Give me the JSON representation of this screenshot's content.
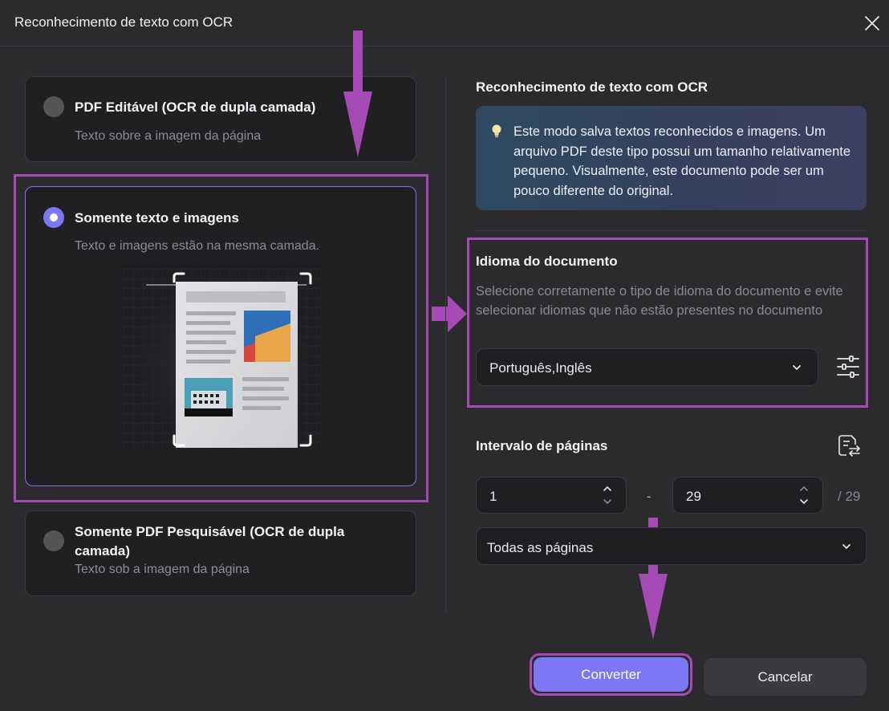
{
  "dialog": {
    "title": "Reconhecimento de texto com OCR"
  },
  "options": [
    {
      "title": "PDF Editável (OCR de dupla camada)",
      "desc": "Texto sobre a imagem da página",
      "selected": false
    },
    {
      "title": "Somente texto e imagens",
      "desc": "Texto e imagens estão na mesma camada.",
      "selected": true
    },
    {
      "title": "Somente PDF Pesquisável (OCR de dupla camada)",
      "desc": "Texto sob a imagem da página",
      "selected": false
    }
  ],
  "right": {
    "section_title": "Reconhecimento de texto com OCR",
    "info_icon": "lightbulb-icon",
    "info_text": "Este modo salva textos reconhecidos e imagens. Um arquivo PDF deste tipo possui um tamanho relativamente pequeno. Visualmente, este documento pode ser um pouco diferente do original.",
    "language": {
      "title": "Idioma do documento",
      "hint": "Selecione corretamente o tipo de idioma do documento e evite selecionar idiomas que não estão presentes no documento",
      "value": "Português,Inglês",
      "settings_icon": "sliders-icon"
    },
    "pages": {
      "title": "Intervalo de páginas",
      "from": "1",
      "separator": "-",
      "to": "29",
      "total": "/ 29",
      "mode": "Todas as páginas",
      "swap_icon": "page-range-icon"
    }
  },
  "buttons": {
    "convert": "Converter",
    "cancel": "Cancelar"
  },
  "colors": {
    "accent": "#7b77f5",
    "highlight": "#a64bb5",
    "background": "#2b2b2e",
    "card": "#202023"
  }
}
